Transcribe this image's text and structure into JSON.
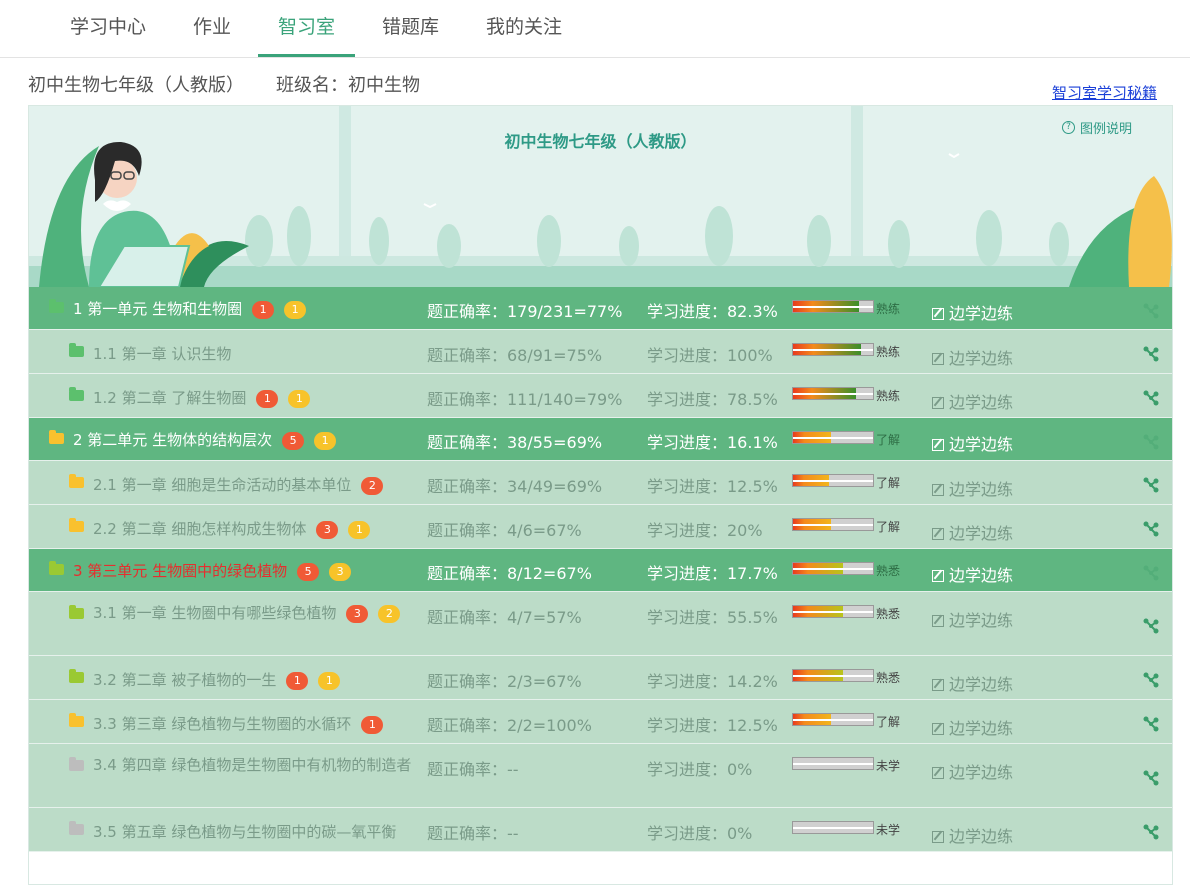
{
  "nav": {
    "tabs": [
      {
        "label": "学习中心",
        "active": false
      },
      {
        "label": "作业",
        "active": false
      },
      {
        "label": "智习室",
        "active": true
      },
      {
        "label": "错题库",
        "active": false
      },
      {
        "label": "我的关注",
        "active": false
      }
    ]
  },
  "header": {
    "course": "初中生物七年级（人教版）",
    "class_label": "班级名：初中生物",
    "secret_link": "智习室学习秘籍"
  },
  "banner": {
    "title": "初中生物七年级（人教版）",
    "legend": "图例说明",
    "legend_icon": "?"
  },
  "rows": [
    {
      "type": "unit",
      "folder": "green",
      "name": "1 第一单元 生物和生物圈",
      "badges": [
        {
          "n": "1",
          "c": "red"
        },
        {
          "n": "1",
          "c": "yellow"
        }
      ],
      "accuracy": "题正确率：179/231=77%",
      "progress": "学习进度：82.3%",
      "pct": 0.823,
      "level": "熟练",
      "learn": "边学边练"
    },
    {
      "type": "chapter",
      "folder": "green",
      "name": "1.1 第一章 认识生物",
      "badges": [],
      "accuracy": "题正确率：68/91=75%",
      "progress": "学习进度：100%",
      "pct": 0.85,
      "level": "熟练",
      "learn": "边学边练"
    },
    {
      "type": "chapter",
      "folder": "green",
      "name": "1.2 第二章 了解生物圈",
      "badges": [
        {
          "n": "1",
          "c": "red"
        },
        {
          "n": "1",
          "c": "yellow"
        }
      ],
      "accuracy": "题正确率：111/140=79%",
      "progress": "学习进度：78.5%",
      "pct": 0.785,
      "level": "熟练",
      "learn": "边学边练"
    },
    {
      "type": "unit",
      "folder": "yellow",
      "name": "2 第二单元 生物体的结构层次",
      "badges": [
        {
          "n": "5",
          "c": "red"
        },
        {
          "n": "1",
          "c": "yellow"
        }
      ],
      "accuracy": "题正确率：38/55=69%",
      "progress": "学习进度：16.1%",
      "pct": 0.48,
      "level": "了解",
      "learn": "边学边练"
    },
    {
      "type": "chapter",
      "folder": "yellow",
      "name": "2.1 第一章 细胞是生命活动的基本单位",
      "badges": [
        {
          "n": "2",
          "c": "red"
        }
      ],
      "accuracy": "题正确率：34/49=69%",
      "progress": "学习进度：12.5%",
      "pct": 0.45,
      "level": "了解",
      "learn": "边学边练"
    },
    {
      "type": "chapter",
      "folder": "yellow",
      "name": "2.2 第二章 细胞怎样构成生物体",
      "badges": [
        {
          "n": "3",
          "c": "red"
        },
        {
          "n": "1",
          "c": "yellow"
        }
      ],
      "accuracy": "题正确率：4/6=67%",
      "progress": "学习进度：20%",
      "pct": 0.48,
      "level": "了解",
      "learn": "边学边练"
    },
    {
      "type": "unit",
      "folder": "lime",
      "red": true,
      "name": "3 第三单元 生物圈中的绿色植物",
      "badges": [
        {
          "n": "5",
          "c": "red"
        },
        {
          "n": "3",
          "c": "yellow"
        }
      ],
      "accuracy": "题正确率：8/12=67%",
      "progress": "学习进度：17.7%",
      "pct": 0.62,
      "level": "熟悉",
      "learn": "边学边练"
    },
    {
      "type": "chapter",
      "tall": true,
      "folder": "lime",
      "name": "3.1 第一章 生物圈中有哪些绿色植物",
      "badges": [
        {
          "n": "3",
          "c": "red"
        },
        {
          "n": "2",
          "c": "yellow"
        }
      ],
      "accuracy": "题正确率：4/7=57%",
      "progress": "学习进度：55.5%",
      "pct": 0.62,
      "level": "熟悉",
      "learn": "边学边练"
    },
    {
      "type": "chapter",
      "folder": "lime",
      "name": "3.2 第二章 被子植物的一生",
      "badges": [
        {
          "n": "1",
          "c": "red"
        },
        {
          "n": "1",
          "c": "yellow"
        }
      ],
      "accuracy": "题正确率：2/3=67%",
      "progress": "学习进度：14.2%",
      "pct": 0.62,
      "level": "熟悉",
      "learn": "边学边练"
    },
    {
      "type": "chapter",
      "folder": "yellow",
      "name": "3.3 第三章 绿色植物与生物圈的水循环",
      "badges": [
        {
          "n": "1",
          "c": "red"
        }
      ],
      "accuracy": "题正确率：2/2=100%",
      "progress": "学习进度：12.5%",
      "pct": 0.48,
      "level": "了解",
      "learn": "边学边练"
    },
    {
      "type": "chapter",
      "tall": true,
      "folder": "gray",
      "name": "3.4 第四章 绿色植物是生物圈中有机物的制造者",
      "badges": [],
      "accuracy": "题正确率：--",
      "progress": "学习进度：0%",
      "pct": 0,
      "level": "未学",
      "learn": "边学边练"
    },
    {
      "type": "chapter",
      "folder": "gray",
      "name": "3.5 第五章 绿色植物与生物圈中的碳—氧平衡",
      "badges": [],
      "accuracy": "题正确率：--",
      "progress": "学习进度：0%",
      "pct": 0,
      "level": "未学",
      "learn": "边学边练"
    }
  ],
  "colors": {
    "accent": "#3aa37a",
    "unit_row": "#5fb681",
    "chapter_row": "#bcdcc8",
    "badge_red": "#f05a36",
    "badge_yellow": "#f7c32a"
  }
}
